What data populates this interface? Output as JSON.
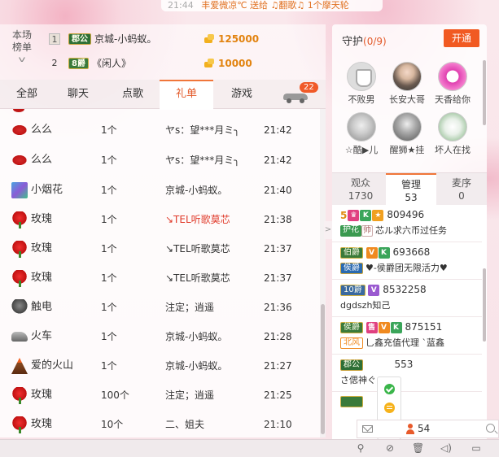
{
  "top_strip": {
    "time": "21:44",
    "message": "丰爱微凉℃ 送给 ♫翻歌♫ 1个摩天轮"
  },
  "rank": {
    "label_line1": "本场",
    "label_line2": "榜单",
    "rows": [
      {
        "num": "1",
        "badge": "郡公",
        "name": "京城-小蚂蚁。",
        "amount": "125000"
      },
      {
        "num": "2",
        "badge": "8爵",
        "name": "《闲人》",
        "amount": "10000"
      }
    ]
  },
  "tabs": [
    "全部",
    "聊天",
    "点歌",
    "礼单",
    "游戏"
  ],
  "car_badge": "22",
  "gift_list": {
    "rows": [
      {
        "gift": "么么",
        "count": "1个",
        "sender": "ヤs：望***月ミ╮",
        "time": "21:42",
        "icon": "lips-icon"
      },
      {
        "gift": "么么",
        "count": "1个",
        "sender": "ヤs：望***月ミ╮",
        "time": "21:42",
        "icon": "lips-icon"
      },
      {
        "gift": "小烟花",
        "count": "1个",
        "sender": "京城-小蚂蚁。",
        "time": "21:40",
        "icon": "firework-icon"
      },
      {
        "gift": "玫瑰",
        "count": "1个",
        "sender": "↘TEL听歌莫芯",
        "time": "21:38",
        "icon": "rose-icon",
        "red": true
      },
      {
        "gift": "玫瑰",
        "count": "1个",
        "sender": "↘TEL听歌莫芯",
        "time": "21:37",
        "icon": "rose-icon"
      },
      {
        "gift": "玫瑰",
        "count": "1个",
        "sender": "↘TEL听歌莫芯",
        "time": "21:37",
        "icon": "rose-icon"
      },
      {
        "gift": "触电",
        "count": "1个",
        "sender": "注定；逍遥",
        "time": "21:36",
        "icon": "eel-icon"
      },
      {
        "gift": "火车",
        "count": "1个",
        "sender": "京城-小蚂蚁。",
        "time": "21:28",
        "icon": "train-icon"
      },
      {
        "gift": "爱的火山",
        "count": "1个",
        "sender": "京城-小蚂蚁。",
        "time": "21:27",
        "icon": "volcano-icon"
      },
      {
        "gift": "玫瑰",
        "count": "100个",
        "sender": "注定；逍遥",
        "time": "21:25",
        "icon": "rose-icon"
      },
      {
        "gift": "玫瑰",
        "count": "10个",
        "sender": "二、姐夫",
        "time": "21:10",
        "icon": "rose-icon"
      }
    ]
  },
  "guard": {
    "title": "守护",
    "count": "(0/9)",
    "open_label": "开通",
    "members": [
      {
        "name": "不败男",
        "avatar": "shield"
      },
      {
        "name": "长安大哥",
        "avatar": "photo"
      },
      {
        "name": "天香给你",
        "avatar": "pink"
      },
      {
        "name": "☆酷▶儿",
        "avatar": "dog"
      },
      {
        "name": "醒狮★挂",
        "avatar": "dark"
      },
      {
        "name": "坏人在找",
        "avatar": "green"
      }
    ]
  },
  "right_tabs": [
    {
      "label": "观众",
      "value": "1730"
    },
    {
      "label": "管理",
      "value": "53"
    },
    {
      "label": "麦序",
      "value": "0"
    }
  ],
  "managers": [
    {
      "level": "5",
      "id": "809496",
      "tag": "护花",
      "tag2": "帅",
      "desc": "芯ル求六币过任务"
    },
    {
      "badge": "伯爵",
      "id": "693668",
      "tag": "侯爵",
      "desc": "♥-侯爵团无限活力♥"
    },
    {
      "badge": "10爵",
      "id": "8532258",
      "desc": "dgdszh知己"
    },
    {
      "badge": "侯爵",
      "id": "875151",
      "tag": "北风",
      "desc": "乚鑫充值代理 `蓝鑫"
    },
    {
      "badge": "郡公",
      "id": "553",
      "desc": "さ偲神ぐ"
    }
  ],
  "chat": {
    "user_count": "54"
  },
  "colors": {
    "accent": "#f15a22",
    "coin": "#e2830f",
    "green": "#3aa55a"
  }
}
